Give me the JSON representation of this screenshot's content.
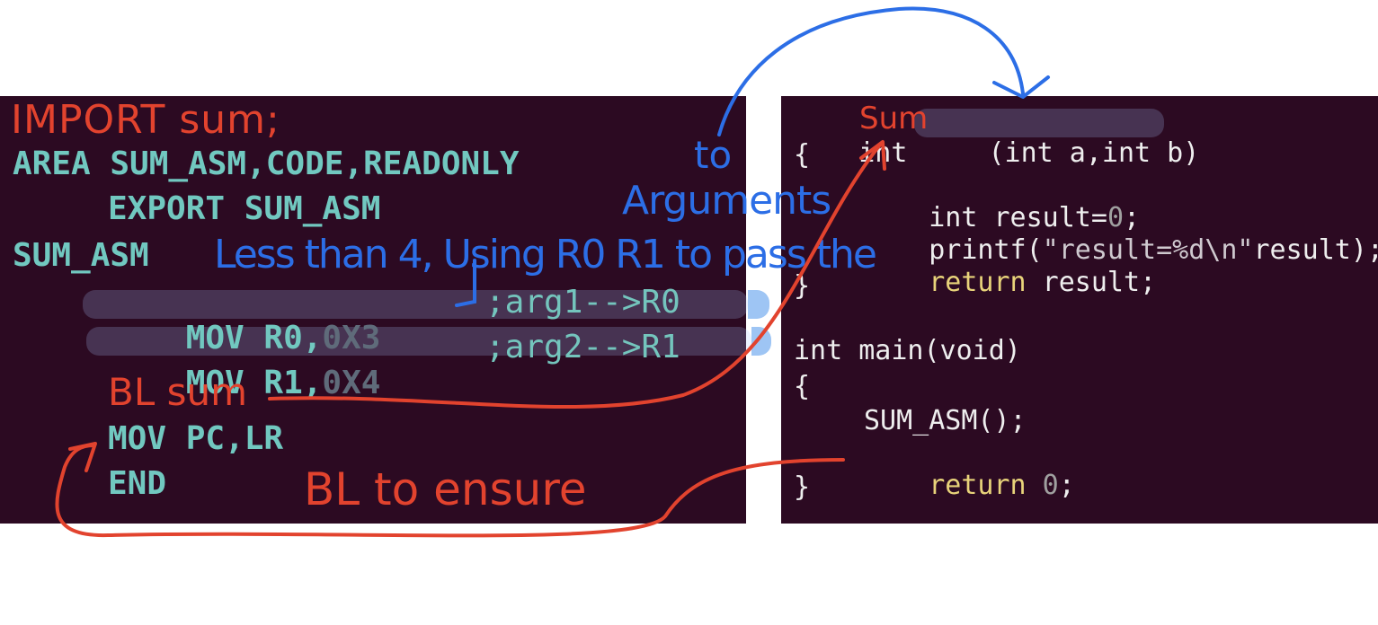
{
  "asm": {
    "line_area": "AREA SUM_ASM,CODE,READONLY",
    "line_export": "EXPORT SUM_ASM",
    "line_label": "SUM_ASM",
    "mov1_op": "MOV R0,",
    "mov1_val": "0X3",
    "mov1_comment": ";arg1-->R0",
    "mov2_op": "MOV R1,",
    "mov2_val": "0X4",
    "mov2_comment": ";arg2-->R1",
    "line_mov_pc": "MOV PC,LR",
    "line_end": "END"
  },
  "c_code": {
    "sig_int": "int ",
    "sig_rest": "(int a,int b)",
    "brace_open_1": "{",
    "decl": "int result=",
    "decl_zero": "0",
    "decl_semi": ";",
    "printf_a": "printf(",
    "printf_str": "\"result=%d\\n\"",
    "printf_b": "result);",
    "ret_kw": "return",
    "ret_rest": " result;",
    "brace_close_1": "}",
    "main_sig": "int main(void)",
    "brace_open_2": "{",
    "call": "SUM_ASM();",
    "ret2_kw": "return",
    "ret2_zero": " 0",
    "ret2_semi": ";",
    "brace_close_2": "}"
  },
  "annotations": {
    "import_sum": "IMPORT sum;",
    "bl_sum": "BL sum",
    "bl_ensure": "BL to ensure",
    "sum_over": "Sum",
    "less_than": "Less than 4, Using R0 R1 to pass the",
    "arguments": "Arguments",
    "to": "to"
  },
  "colors": {
    "editor_bg": "#2c0a22",
    "asm_text": "#71c8c0",
    "ink_red": "#e2432e",
    "ink_blue": "#2c6ee6",
    "highlight": "#9ec5f4"
  }
}
